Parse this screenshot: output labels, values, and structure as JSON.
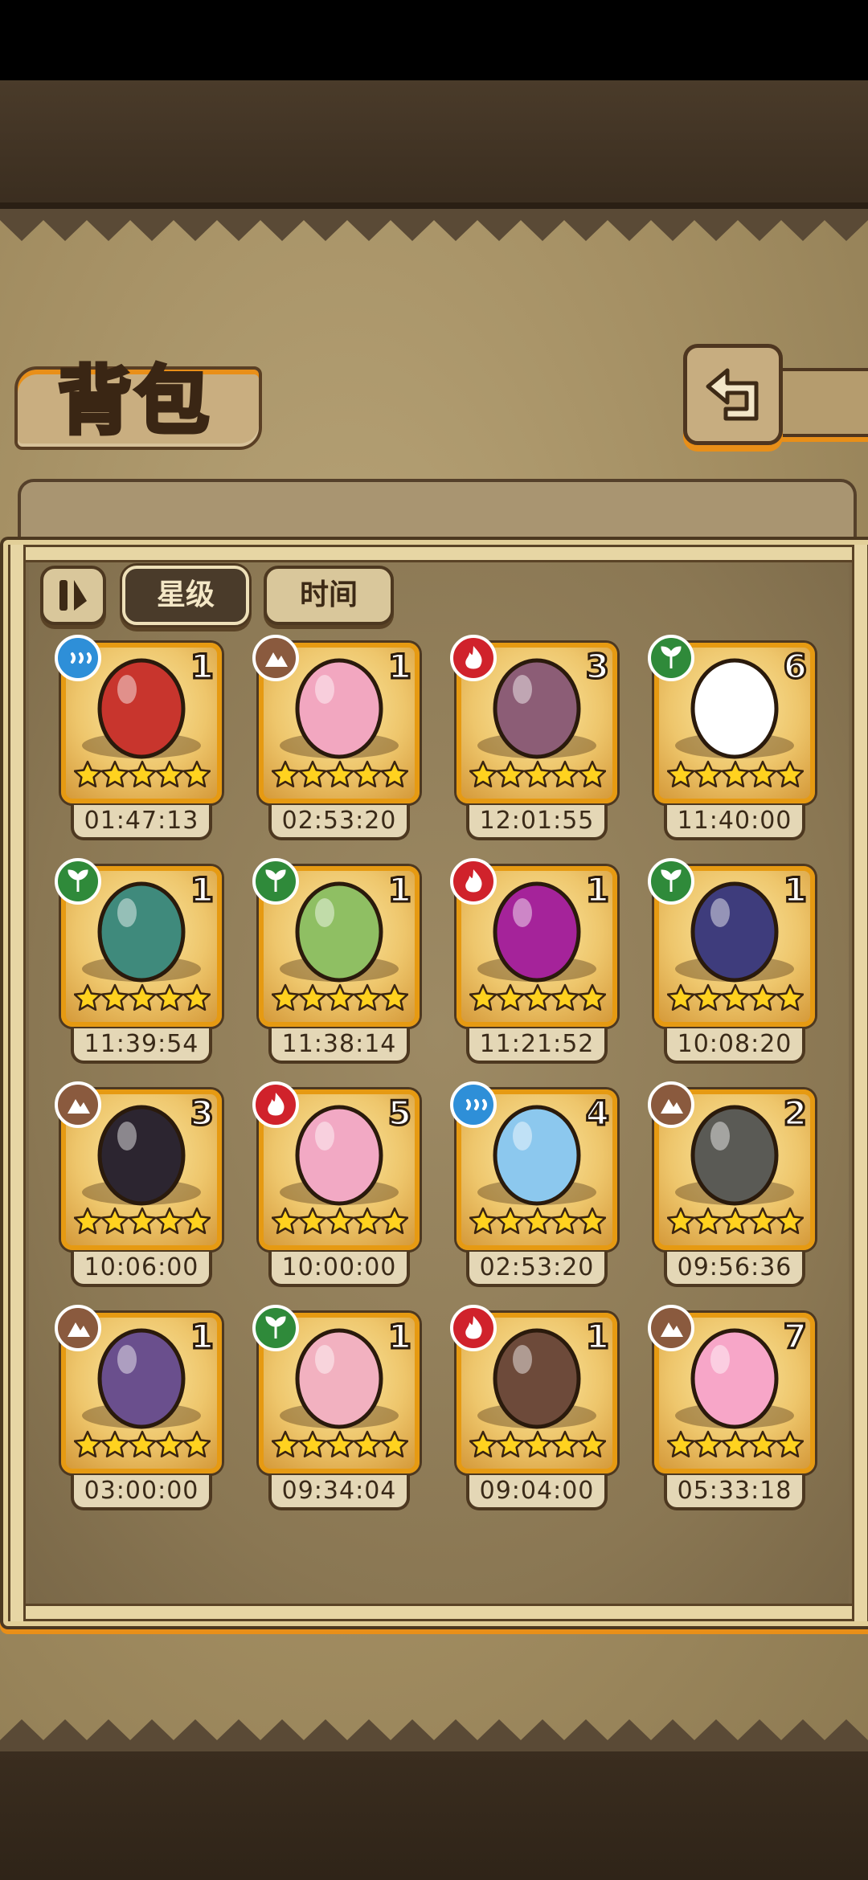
{
  "header": {
    "title": "背包"
  },
  "sort_buttons": {
    "star": "星级",
    "time": "时间"
  },
  "colors": {
    "water": "#2e8fd8",
    "earth": "#8a5a3e",
    "fire": "#d0222b",
    "grass": "#2f8a3a",
    "frame": "#e69a12",
    "star": "#ffd21f"
  },
  "items": [
    {
      "element": "water",
      "count": "1",
      "stars": 5,
      "timer": "01:47:13",
      "icon": "red-spotted-egg-in-nest-icon"
    },
    {
      "element": "earth",
      "count": "1",
      "stars": 5,
      "timer": "02:53:20",
      "icon": "pink-heart-egg-icon"
    },
    {
      "element": "fire",
      "count": "3",
      "stars": 5,
      "timer": "12:01:55",
      "icon": "swirl-egg-with-thorns-icon"
    },
    {
      "element": "grass",
      "count": "6",
      "stars": 5,
      "timer": "11:40:00",
      "icon": "white-egg-with-laurel-icon"
    },
    {
      "element": "grass",
      "count": "1",
      "stars": 5,
      "timer": "11:39:54",
      "icon": "teal-egg-with-flowers-icon"
    },
    {
      "element": "grass",
      "count": "1",
      "stars": 5,
      "timer": "11:38:14",
      "icon": "green-egg-on-scarf-icon"
    },
    {
      "element": "fire",
      "count": "1",
      "stars": 5,
      "timer": "11:21:52",
      "icon": "purple-orb-egg-icon"
    },
    {
      "element": "grass",
      "count": "1",
      "stars": 5,
      "timer": "10:08:20",
      "icon": "dark-crystal-egg-icon"
    },
    {
      "element": "earth",
      "count": "3",
      "stars": 5,
      "timer": "10:06:00",
      "icon": "coffin-icon"
    },
    {
      "element": "fire",
      "count": "5",
      "stars": 5,
      "timer": "10:00:00",
      "icon": "pink-cream-cake-egg-icon"
    },
    {
      "element": "water",
      "count": "4",
      "stars": 5,
      "timer": "02:53:20",
      "icon": "blue-heart-egg-icon"
    },
    {
      "element": "earth",
      "count": "2",
      "stars": 5,
      "timer": "09:56:36",
      "icon": "stone-egg-with-blue-fire-icon"
    },
    {
      "element": "earth",
      "count": "1",
      "stars": 5,
      "timer": "03:00:00",
      "icon": "purple-crown-egg-icon"
    },
    {
      "element": "grass",
      "count": "1",
      "stars": 5,
      "timer": "09:34:04",
      "icon": "pink-pig-egg-icon"
    },
    {
      "element": "fire",
      "count": "1",
      "stars": 5,
      "timer": "09:04:00",
      "icon": "armored-brown-egg-icon"
    },
    {
      "element": "earth",
      "count": "7",
      "stars": 5,
      "timer": "05:33:18",
      "icon": "pink-bunny-egg-icon"
    }
  ]
}
